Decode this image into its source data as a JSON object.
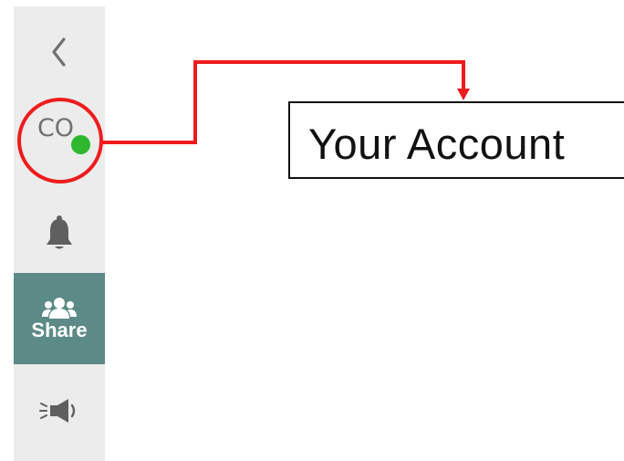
{
  "sidebar": {
    "back_icon": "chevron-left-icon",
    "avatar_initials": "CO",
    "avatar_status_color": "#2eb82e",
    "notification_icon": "bell-icon",
    "share_icon": "people-icon",
    "share_label": "Share",
    "share_bg_color": "#5b8a87",
    "announcement_icon": "megaphone-icon",
    "bg_color": "#ececec"
  },
  "annotation": {
    "label": "Your Account",
    "highlight_color": "#ee1c1c"
  }
}
